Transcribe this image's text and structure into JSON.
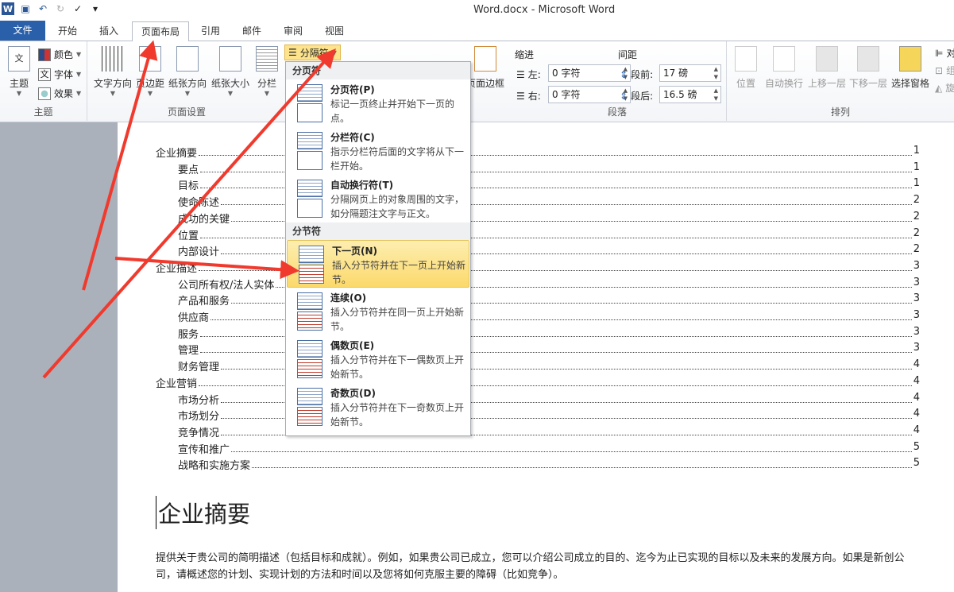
{
  "window": {
    "title": "Word.docx  -  Microsoft Word"
  },
  "tabs": [
    "文件",
    "开始",
    "插入",
    "页面布局",
    "引用",
    "邮件",
    "审阅",
    "视图"
  ],
  "ribbon": {
    "theme": {
      "label": "主题",
      "themes": "主题",
      "colors": "颜色",
      "fonts": "字体",
      "effects": "效果"
    },
    "page_setup": {
      "label": "页面设置",
      "text_direction": "文字方向",
      "margins": "页边距",
      "orientation": "纸张方向",
      "size": "纸张大小",
      "columns": "分栏",
      "breaks": "分隔符"
    },
    "page_bg": {
      "borders": "页面边框"
    },
    "paragraph": {
      "label": "段落",
      "indent": "缩进",
      "spacing": "间距",
      "left_label": "左:",
      "left_value": "0 字符",
      "right_label": "右:",
      "right_value": "0 字符",
      "before_label": "段前:",
      "before_value": "17 磅",
      "after_label": "段后:",
      "after_value": "16.5 磅"
    },
    "arrange": {
      "label": "排列",
      "position": "位置",
      "wrap": "自动换行",
      "forward": "上移一层",
      "backward": "下移一层",
      "selection_pane": "选择窗格",
      "align": "对",
      "group": "组",
      "rotate": "旋"
    }
  },
  "breaks_menu": {
    "section1": "分页符",
    "section2": "分节符",
    "items": [
      {
        "title": "分页符(P)",
        "desc": "标记一页终止并开始下一页的点。"
      },
      {
        "title": "分栏符(C)",
        "desc": "指示分栏符后面的文字将从下一栏开始。"
      },
      {
        "title": "自动换行符(T)",
        "desc": "分隔网页上的对象周围的文字，如分隔题注文字与正文。"
      },
      {
        "title": "下一页(N)",
        "desc": "插入分节符并在下一页上开始新节。"
      },
      {
        "title": "连续(O)",
        "desc": "插入分节符并在同一页上开始新节。"
      },
      {
        "title": "偶数页(E)",
        "desc": "插入分节符并在下一偶数页上开始新节。"
      },
      {
        "title": "奇数页(D)",
        "desc": "插入分节符并在下一奇数页上开始新节。"
      }
    ]
  },
  "toc": [
    {
      "t": "企业摘要",
      "p": "1",
      "l": 1
    },
    {
      "t": "要点",
      "p": "1",
      "l": 2
    },
    {
      "t": "目标",
      "p": "1",
      "l": 2
    },
    {
      "t": "使命陈述",
      "p": "2",
      "l": 2
    },
    {
      "t": "成功的关键",
      "p": "2",
      "l": 2
    },
    {
      "t": "位置",
      "p": "2",
      "l": 2
    },
    {
      "t": "内部设计",
      "p": "2",
      "l": 2
    },
    {
      "t": "企业描述",
      "p": "3",
      "l": 1
    },
    {
      "t": "公司所有权/法人实体",
      "p": "3",
      "l": 2
    },
    {
      "t": "产品和服务",
      "p": "3",
      "l": 2
    },
    {
      "t": "供应商",
      "p": "3",
      "l": 2
    },
    {
      "t": "服务",
      "p": "3",
      "l": 2
    },
    {
      "t": "管理",
      "p": "3",
      "l": 2
    },
    {
      "t": "财务管理",
      "p": "4",
      "l": 2
    },
    {
      "t": "企业营销",
      "p": "4",
      "l": 1
    },
    {
      "t": "市场分析",
      "p": "4",
      "l": 2
    },
    {
      "t": "市场划分",
      "p": "4",
      "l": 2
    },
    {
      "t": "竞争情况",
      "p": "4",
      "l": 2
    },
    {
      "t": "宣传和推广",
      "p": "5",
      "l": 2
    },
    {
      "t": "战略和实施方案",
      "p": "5",
      "l": 2
    }
  ],
  "document": {
    "heading": "企业摘要",
    "paragraph": "提供关于贵公司的简明描述（包括目标和成就）。例如，如果贵公司已成立，您可以介绍公司成立的目的、迄今为止已实现的目标以及未来的发展方向。如果是新创公司，请概述您的计划、实现计划的方法和时间以及您将如何克服主要的障碍（比如竞争）。"
  },
  "colors": {
    "file_tab": "#2a5fa9",
    "highlight": "#fbd96b",
    "annotation": "#f03a2e"
  }
}
